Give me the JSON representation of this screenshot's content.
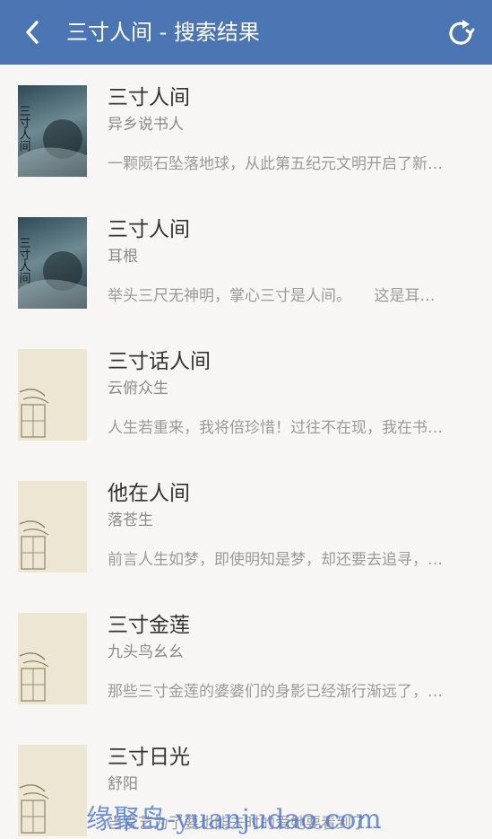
{
  "header": {
    "title": "三寸人间 - 搜索结果",
    "back_icon": "chevron-left-icon",
    "refresh_icon": "refresh-icon",
    "color": "#4c75b4"
  },
  "results": [
    {
      "title": "三寸人间",
      "author": "异乡说书人",
      "desc": "一颗陨石坠落地球，从此第五纪元文明开启了新…",
      "cover": "dark-cover-art",
      "cover_text": "三寸人间"
    },
    {
      "title": "三寸人间",
      "author": "耳根",
      "desc": "举头三尺无神明，掌心三寸是人间。　　这是耳…",
      "cover": "dark-cover-art",
      "cover_text": "三寸人间"
    },
    {
      "title": "三寸话人间",
      "author": "云俯众生",
      "desc": "人生若重来，我将倍珍惜！过往不在现，我在书…",
      "cover": "default-cover"
    },
    {
      "title": "他在人间",
      "author": "落苍生",
      "desc": "前言人生如梦，即使明知是梦，却还要去追寻，…",
      "cover": "default-cover"
    },
    {
      "title": "三寸金莲",
      "author": "九头鸟幺幺",
      "desc": "那些三寸金莲的婆婆们的身影已经渐行渐远了，…",
      "cover": "default-cover"
    },
    {
      "title": "三寸日光",
      "author": "舒阳",
      "desc": "当爱艺为了要也能去时的爱她要看到了…",
      "cover": "default-cover"
    }
  ],
  "watermark": "缘聚岛-yuanjudao.com"
}
